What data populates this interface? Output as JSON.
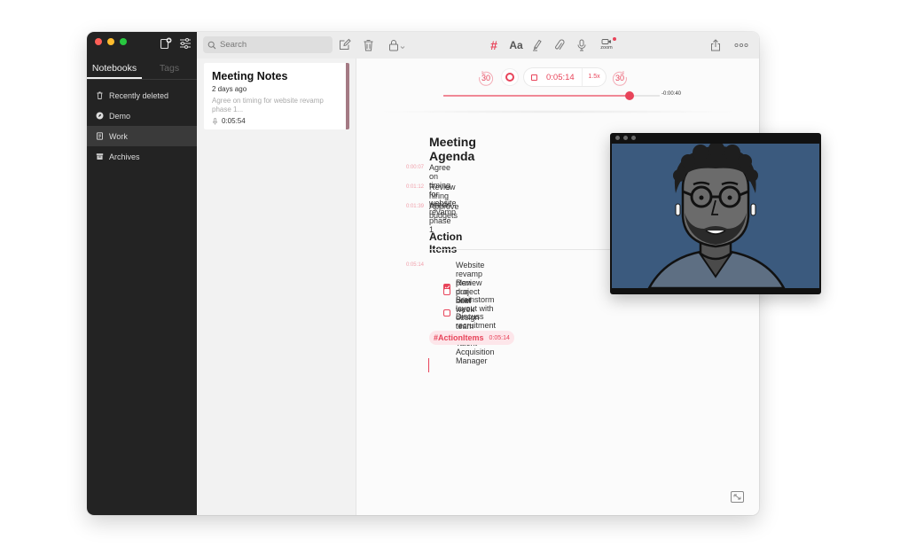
{
  "sidebar": {
    "tabs": [
      {
        "label": "Notebooks",
        "active": true
      },
      {
        "label": "Tags",
        "active": false
      }
    ],
    "items": [
      {
        "label": "Recently deleted",
        "icon": "trash-icon"
      },
      {
        "label": "Demo",
        "icon": "compass-icon"
      },
      {
        "label": "Work",
        "icon": "notebook-icon",
        "selected": true
      },
      {
        "label": "Archives",
        "icon": "archive-icon"
      }
    ]
  },
  "notelist": {
    "search_placeholder": "Search",
    "card": {
      "title": "Meeting Notes",
      "date": "2 days ago",
      "preview": "Agree on timing for website revamp phase 1...",
      "audio_duration": "0:05:54"
    }
  },
  "player": {
    "skip_back": "30",
    "skip_forward": "30",
    "time": "0:05:14",
    "speed": "1.5x",
    "remaining": "-0:00:40",
    "progress": 0.86
  },
  "toolbar": {
    "zoom_label": "zoom"
  },
  "document": {
    "heading": "Meeting Agenda",
    "agenda": [
      {
        "time": "0:00:07",
        "text": "Agree on timing for website revamp phase 1"
      },
      {
        "time": "0:01:12",
        "text": "Review hiring needs"
      },
      {
        "time": "0:01:39",
        "text": "Approve budgets"
      }
    ],
    "action_heading": "Action Items",
    "action_time": "0:05:14",
    "todos": [
      {
        "text": "Website revamp plan due next week",
        "checked": true
      },
      {
        "text": "Review project brief",
        "checked": false
      },
      {
        "text": "Brainstorm layout with design team",
        "checked": false
      },
      {
        "text": "Discuss recruitment goals with Talent Acquisition Manager",
        "checked": false
      }
    ],
    "tag": {
      "name": "#ActionItems",
      "time": "0:05:14"
    }
  },
  "colors": {
    "accent": "#e8445a",
    "sidebar_bg": "#232323",
    "video_bg": "#3b5a7e"
  }
}
